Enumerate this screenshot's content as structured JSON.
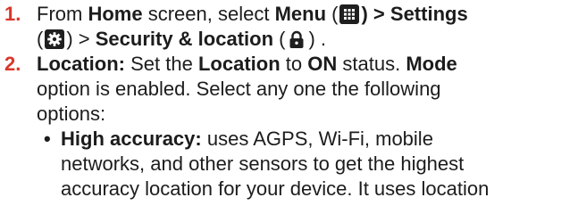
{
  "colors": {
    "number": "#d9372c",
    "text": "#1c1c1c",
    "icon_bg": "#1f1f1f"
  },
  "step1": {
    "number": "1.",
    "t_from": "From",
    "t_home": "Home",
    "t_screen_select": "screen, select",
    "t_menu": "Menu",
    "paren_open": "(",
    "menu_icon": "grid-menu-icon",
    "t_close_gt": ") >",
    "t_settings": "Settings",
    "settings_icon": "gear-icon",
    "t_close_gt2": ") >",
    "t_security": "Security & location",
    "security_icon": "lock-icon",
    "t_close_end": ") ."
  },
  "step2": {
    "number": "2.",
    "t_location_label": "Location:",
    "t_set_the": "Set the",
    "t_location": "Location",
    "t_to": "to",
    "t_on": "ON",
    "t_status": "status.",
    "t_mode": "Mode",
    "t_line2": "option is enabled. Select any one the following",
    "t_line3": "options:"
  },
  "bullet1": {
    "dot": "•",
    "t_label": "High accuracy:",
    "t_line1_rest": "uses AGPS, Wi-Fi, mobile",
    "t_line2": "networks, and other sensors to get the highest",
    "t_line3": "accuracy location for your device. It uses location"
  }
}
